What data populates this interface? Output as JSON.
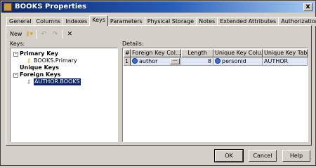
{
  "window": {
    "title": "BOOKS Properties",
    "close_glyph": "x"
  },
  "tabs": [
    {
      "label": "General"
    },
    {
      "label": "Columns"
    },
    {
      "label": "Indexes"
    },
    {
      "label": "Keys"
    },
    {
      "label": "Parameters"
    },
    {
      "label": "Physical Storage"
    },
    {
      "label": "Notes"
    },
    {
      "label": "Extended Attributes"
    },
    {
      "label": "Authorization"
    }
  ],
  "active_tab": "Keys",
  "toolbar": {
    "new_label": "New"
  },
  "keys_panel": {
    "label": "Keys:",
    "tree": {
      "primary_key": {
        "label": "Primary Key",
        "toggle": "-",
        "child": "BOOKS.Primary"
      },
      "unique_keys": {
        "label": "Unique Keys"
      },
      "foreign_keys": {
        "label": "Foreign Keys",
        "toggle": "-",
        "child": "AUTHOR.BOOKS"
      }
    }
  },
  "details_panel": {
    "label": "Details:",
    "columns": [
      "#",
      "Foreign Key Col...",
      "Length",
      "Unique Key Colu...",
      "Unique Key Table"
    ],
    "rows": [
      {
        "num": "1",
        "fk_column": "author",
        "length": "8",
        "uk_column": "personid",
        "uk_table": "AUTHOR"
      }
    ]
  },
  "buttons": {
    "ok": "OK",
    "cancel": "Cancel",
    "help": "Help"
  },
  "colors": {
    "titlebar": "#0a246a",
    "selection": "#0a246a",
    "face": "#d4d0c8"
  }
}
